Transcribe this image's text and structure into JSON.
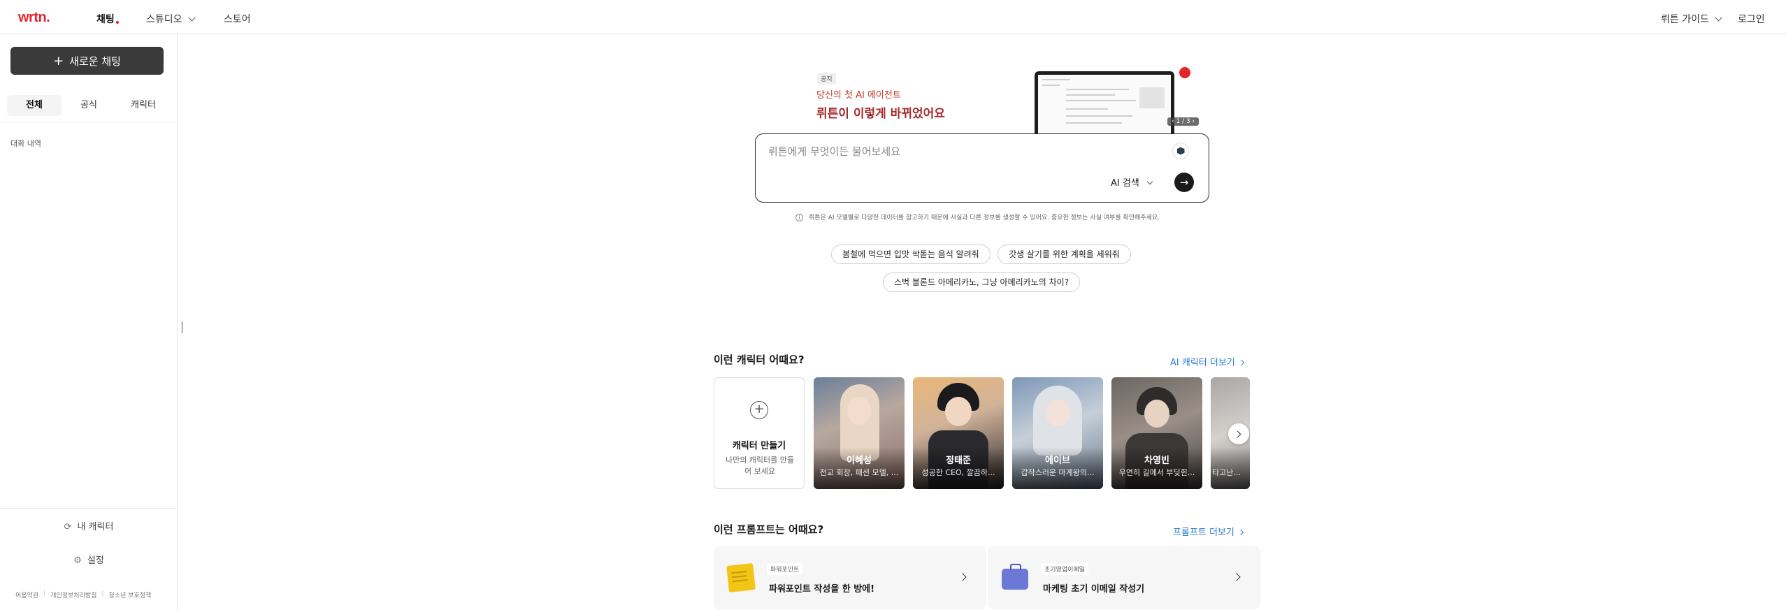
{
  "nav": {
    "logo": "wrtn.",
    "chat": "채팅",
    "studio": "스튜디오",
    "store": "스토어",
    "guide": "뤼튼 가이드",
    "login": "로그인"
  },
  "sidebar": {
    "new_chat": "새로운 채팅",
    "tabs": [
      {
        "label": "전체",
        "active": true
      },
      {
        "label": "공식",
        "active": false
      },
      {
        "label": "캐릭터",
        "active": false
      }
    ],
    "history_label": "대화 내역",
    "my_characters": "내 캐릭터",
    "settings": "설정",
    "footer": [
      "이용약관",
      "개인정보처리방침",
      "청소년 보호정책"
    ]
  },
  "banner": {
    "badge": "공지",
    "subtitle": "당신의 첫 AI 에이전트",
    "title": "뤼튼이 이렇게 바뀌었어요",
    "pager": "‹ 1 / 3 ›"
  },
  "search": {
    "placeholder": "뤼튼에게 무엇이든 물어보세요",
    "mode": "AI 검색"
  },
  "disclaimer": "뤼튼은 AI 모델별로 다양한 데이터를 참고하기 때문에 사실과 다른 정보를 생성할 수 있어요. 중요한 정보는 사실 여부를 확인해주세요.",
  "suggestions": [
    "봄철에 먹으면 입맛 싹돋는 음식 알려줘",
    "갓생 살기를 위한 계획을 세워줘",
    "스벅 블론드 아메리카노, 그냥 아메리카노의 차이?"
  ],
  "characters_section": {
    "title": "이런 캐릭터 어때요?",
    "more": "AI 캐릭터 더보기",
    "create": {
      "title": "캐릭터 만들기",
      "desc": "나만의 캐릭터를 만들어 보세요"
    },
    "cards": [
      {
        "name": "이혜성",
        "desc": "전교 회장, 패션 모델, ..."
      },
      {
        "name": "정태준",
        "desc": "성공한 CEO, 깔끔하..."
      },
      {
        "name": "에이브",
        "desc": "갑작스러운 마계왕의..."
      },
      {
        "name": "차영빈",
        "desc": "우연히 길에서 부딪힌..."
      },
      {
        "name": "",
        "desc": "타고난..."
      }
    ]
  },
  "prompts_section": {
    "title": "이런 프롬프트는 어때요?",
    "more": "프롬프트 더보기",
    "cards": [
      {
        "category": "파워포인트",
        "title": "파워포인트 작성을 한 방에!",
        "icon": "notepad-icon"
      },
      {
        "category": "초기영업이메일",
        "title": "마케팅 초기 이메일 작성기",
        "icon": "briefcase-icon"
      }
    ]
  },
  "colors": {
    "brand": "#e5252a",
    "link": "#2a7ad5",
    "banner_title": "#a52a2a"
  }
}
